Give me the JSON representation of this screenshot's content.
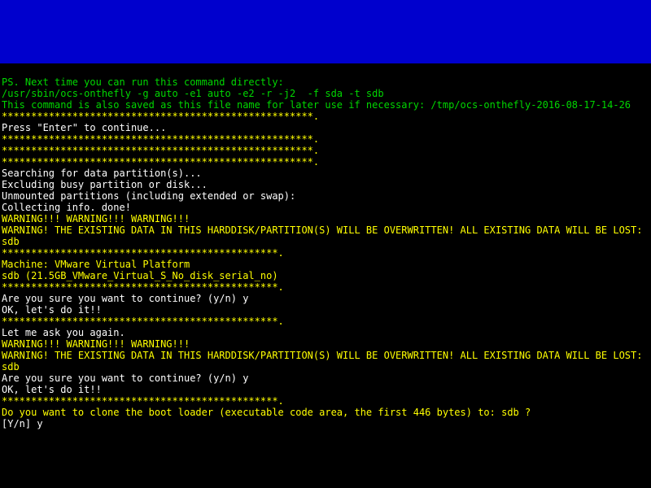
{
  "banner": {},
  "lines": {
    "ps_next_time": "PS. Next time you can run this command directly:",
    "command": "/usr/sbin/ocs-onthefly -g auto -e1 auto -e2 -r -j2  -f sda -t sdb",
    "saved_as": "This command is also saved as this file name for later use if necessary: /tmp/ocs-onthefly-2016-08-17-14-26",
    "stars1": "*****************************************************.",
    "press_enter": "Press \"Enter\" to continue...",
    "stars2": "*****************************************************.",
    "stars3": "*****************************************************.",
    "stars4": "*****************************************************.",
    "searching": "Searching for data partition(s)...",
    "excluding": "Excluding busy partition or disk...",
    "unmounted": "Unmounted partitions (including extended or swap):",
    "collecting": "Collecting info. done!",
    "warn_triple1": "WARNING!!! WARNING!!! WARNING!!!",
    "warn_overwrite1": "WARNING! THE EXISTING DATA IN THIS HARDDISK/PARTITION(S) WILL BE OVERWRITTEN! ALL EXISTING DATA WILL BE LOST: sdb",
    "stars5": "***********************************************.",
    "machine": "Machine: VMware Virtual Platform",
    "sdb_info": "sdb (21.5GB_VMware_Virtual_S_No_disk_serial_no)",
    "stars6": "***********************************************.",
    "are_you_sure1": "Are you sure you want to continue? (y/n) y",
    "ok1": "OK, let's do it!!",
    "stars7": "***********************************************.",
    "ask_again": "Let me ask you again.",
    "warn_triple2": "WARNING!!! WARNING!!! WARNING!!!",
    "warn_overwrite2": "WARNING! THE EXISTING DATA IN THIS HARDDISK/PARTITION(S) WILL BE OVERWRITTEN! ALL EXISTING DATA WILL BE LOST: sdb",
    "are_you_sure2": "Are you sure you want to continue? (y/n) y",
    "ok2": "OK, let's do it!!",
    "stars8": "***********************************************.",
    "clone_boot": "Do you want to clone the boot loader (executable code area, the first 446 bytes) to: sdb ?",
    "prompt": "[Y/n] y"
  }
}
